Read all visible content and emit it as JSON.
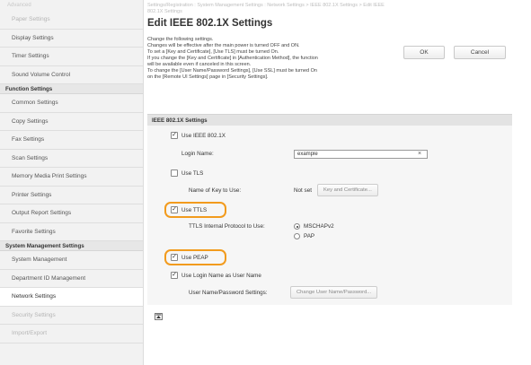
{
  "sidebar": {
    "top_cut": "Advanced",
    "items_a": [
      {
        "label": "Paper Settings",
        "faded": true
      },
      {
        "label": "Display Settings"
      },
      {
        "label": "Timer Settings"
      },
      {
        "label": "Sound Volume Control"
      }
    ],
    "section_function": "Function Settings",
    "items_b": [
      {
        "label": "Common Settings"
      },
      {
        "label": "Copy Settings"
      },
      {
        "label": "Fax Settings"
      },
      {
        "label": "Scan Settings"
      },
      {
        "label": "Memory Media Print Settings"
      },
      {
        "label": "Printer Settings"
      },
      {
        "label": "Output Report Settings"
      },
      {
        "label": "Favorite Settings"
      }
    ],
    "section_system": "System Management Settings",
    "items_c": [
      {
        "label": "System Management"
      },
      {
        "label": "Department ID Management"
      },
      {
        "label": "Network Settings",
        "selected": true
      },
      {
        "label": "Security Settings",
        "faded": true
      },
      {
        "label": "Import/Export",
        "faded": true
      }
    ]
  },
  "breadcrumb": {
    "line1": "Settings/Registration : System Management Settings : Network Settings > IEEE 802.1X Settings > Edit IEEE",
    "line2": "802.1X Settings"
  },
  "title": "Edit IEEE 802.1X Settings",
  "intro_lines": [
    "Change the following settings.",
    "Changes will be effective after the main power is turned OFF and ON.",
    "To set a [Key and Certificate], [Use TLS] must be turned On.",
    "If you change the [Key and Certificate] in [Authentication Method], the function",
    "will be available even if canceled in this screen.",
    "To change the [User Name/Password Settings], [Use SSL] must be turned On",
    "on the [Remote UI Settings] page in [Security Settings]."
  ],
  "buttons": {
    "ok": "OK",
    "cancel": "Cancel"
  },
  "panel": {
    "header": "IEEE 802.1X Settings",
    "use_ieee": {
      "label": "Use IEEE 802.1X",
      "checked": true
    },
    "login_name": {
      "label": "Login Name:",
      "value": "example",
      "clear": "×"
    },
    "use_tls": {
      "label": "Use TLS",
      "checked": false
    },
    "key_name": {
      "label": "Name of Key to Use:",
      "value": "Not set",
      "button": "Key and Certificate..."
    },
    "use_ttls": {
      "label": "Use TTLS",
      "checked": true
    },
    "ttls_protocol": {
      "label": "TTLS Internal Protocol to Use:",
      "options": [
        "MSCHAPv2",
        "PAP"
      ],
      "selected": "MSCHAPv2"
    },
    "use_peap": {
      "label": "Use PEAP",
      "checked": true
    },
    "use_login_as_user": {
      "label": "Use Login Name as User Name",
      "checked": true
    },
    "user_pass": {
      "label": "User Name/Password Settings:",
      "button": "Change User Name/Password..."
    }
  },
  "check_glyph": "✓",
  "colors": {
    "highlight": "#f29b1d",
    "sidebar_bg": "#f2f2f2",
    "panel_bg": "#f6f6f6"
  }
}
